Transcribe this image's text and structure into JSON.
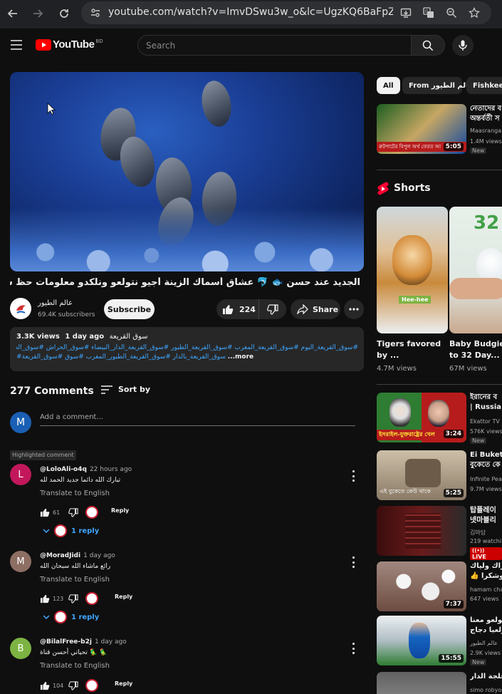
{
  "browser": {
    "url": "youtube.com/watch?v=ImvDSwu3w_o&lc=UgzKQ6BaFpZ5Kxp..."
  },
  "header": {
    "logo_text": "YouTube",
    "region": "BD",
    "search_placeholder": "Search"
  },
  "video": {
    "title": "الجديد عند حسن 🐟 🐬 عشاق أسماك الزينة أجيو نتولعو ونلكدو معلومات حظ سعيد للجميع فالمسابقة",
    "channel_name": "عالم الطيور",
    "subscribers": "69.4K subscribers",
    "subscribe_label": "Subscribe",
    "likes": "224",
    "share_label": "Share",
    "description": {
      "views": "3.3K views",
      "age": "1 day ago",
      "location": "سوق القريعة",
      "tags_line1": "#سوق_القريعة_اليوم #سوق_القريعة_المغرب #سوق_القريعة_الطيور #سوق_القريعة_الدار_البيضاء #سوق_الحراش #سوق_الطيور",
      "tags_line2": "#سوق_القريعة_بالدار #سوق_القريعة_الطيور_المغرب #سوق #سوق_القريعة",
      "more": "...more"
    }
  },
  "comments": {
    "count_label": "277 Comments",
    "sort_label": "Sort by",
    "my_initial": "M",
    "add_placeholder": "Add a comment...",
    "highlighted_label": "Highlighted comment",
    "translate_label": "Translate to English",
    "reply_label": "Reply",
    "items": [
      {
        "initial": "L",
        "author": "@LoloAli-o4q",
        "time": "22 hours ago",
        "text": "تبارك الله دائما جديد الحمد لله",
        "likes": "61",
        "replies": "1 reply",
        "avatar_color": "#c2185b"
      },
      {
        "initial": "M",
        "author": "@MoradJidi",
        "time": "1 day ago",
        "text": "رائع ماشاء الله سبحان الله",
        "likes": "123",
        "replies": "1 reply",
        "avatar_color": "#8d6e63"
      },
      {
        "initial": "B",
        "author": "@BilalFree-b2j",
        "time": "1 day ago",
        "text": "تحياتي أحسن قناة 🦜 🦜",
        "likes": "104",
        "replies": "",
        "avatar_color": "#7cb342"
      }
    ]
  },
  "sidebar": {
    "chips": [
      "All",
      "From عالم الطيور",
      "Fishkeep"
    ],
    "related": [
      {
        "title_line1": "নেতাদের ব",
        "title_line2": "অন্তর্বর্তী স",
        "channel": "Maasranga",
        "views": "1.4M views",
        "badge": "New",
        "duration": "5:05",
        "thumb_caption": "রুটপাটের বিপুল অর্থ ফেরত আ"
      },
      {
        "title_line1": "ইরানের ব",
        "title_line2": "| Russia |",
        "channel": "Ekattor TV",
        "views": "576K views",
        "badge": "New",
        "duration": "3:24",
        "thumb_caption": "ইসরাইল-যুক্তরাষ্ট্রের খেল"
      },
      {
        "title_line1": "Ei Bukete",
        "title_line2": "বুকেতে কে",
        "channel": "Infinite Pea",
        "views": "9.7M views",
        "badge": "",
        "duration": "5:25",
        "thumb_caption": "এই বুকেতে কেউ থাকে"
      },
      {
        "title_line1": "탑플레이",
        "title_line2": "넷마블리",
        "channel": "김마담",
        "views": "219 watchi",
        "badge": "LIVE",
        "duration": "",
        "thumb_caption": ""
      },
      {
        "title_line1": "اشتراك ولياك",
        "title_line2": "👍 وشكرا",
        "channel": "hamam cha",
        "views": "647 views",
        "badge": "",
        "duration": "7:37",
        "thumb_caption": ""
      },
      {
        "title_line1": "تولعو معنا",
        "title_line2": "المولعيا دجاج",
        "channel": "عالم الطيور",
        "views": "2.9K views",
        "badge": "New",
        "duration": "15:55",
        "thumb_caption": ""
      },
      {
        "title_line1": "ي لجلجة الدار",
        "title_line2": "",
        "channel": "simo robyo",
        "views": "",
        "badge": "",
        "duration": "",
        "thumb_caption": ""
      }
    ],
    "shorts_label": "Shorts",
    "shorts": [
      {
        "title": "Tigers favored by ...",
        "views": "4.7M views",
        "overlay": "Hee-hee"
      },
      {
        "title": "Baby Budgie 1 to 32 Day...",
        "views": "67M views",
        "overlay": "32"
      }
    ]
  }
}
